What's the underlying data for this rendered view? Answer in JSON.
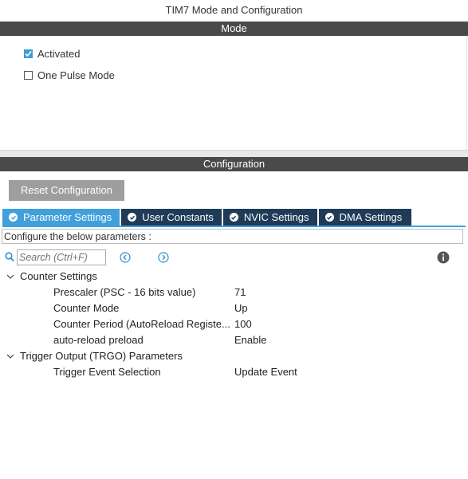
{
  "window": {
    "title": "TIM7 Mode and Configuration"
  },
  "mode": {
    "header": "Mode",
    "options": [
      {
        "label": "Activated",
        "checked": true
      },
      {
        "label": "One Pulse Mode",
        "checked": false
      }
    ]
  },
  "configuration": {
    "header": "Configuration",
    "reset_label": "Reset Configuration",
    "tabs": [
      {
        "label": "Parameter Settings",
        "active": true
      },
      {
        "label": "User Constants",
        "active": false
      },
      {
        "label": "NVIC Settings",
        "active": false
      },
      {
        "label": "DMA Settings",
        "active": false
      }
    ],
    "configure_label": "Configure the below parameters :",
    "search": {
      "placeholder": "Search (Ctrl+F)"
    },
    "groups": [
      {
        "name": "Counter Settings",
        "params": [
          {
            "name": "Prescaler (PSC - 16 bits value)",
            "value": "71"
          },
          {
            "name": "Counter Mode",
            "value": "Up"
          },
          {
            "name": "Counter Period (AutoReload Registe...",
            "value": "100"
          },
          {
            "name": "auto-reload preload",
            "value": "Enable"
          }
        ]
      },
      {
        "name": "Trigger Output (TRGO) Parameters",
        "params": [
          {
            "name": "Trigger Event Selection",
            "value": "Update Event"
          }
        ]
      }
    ]
  },
  "colors": {
    "accent": "#40a0dc",
    "tab_inactive": "#1f3b57",
    "section_bar": "#4a4a4a",
    "button": "#9e9e9e"
  }
}
